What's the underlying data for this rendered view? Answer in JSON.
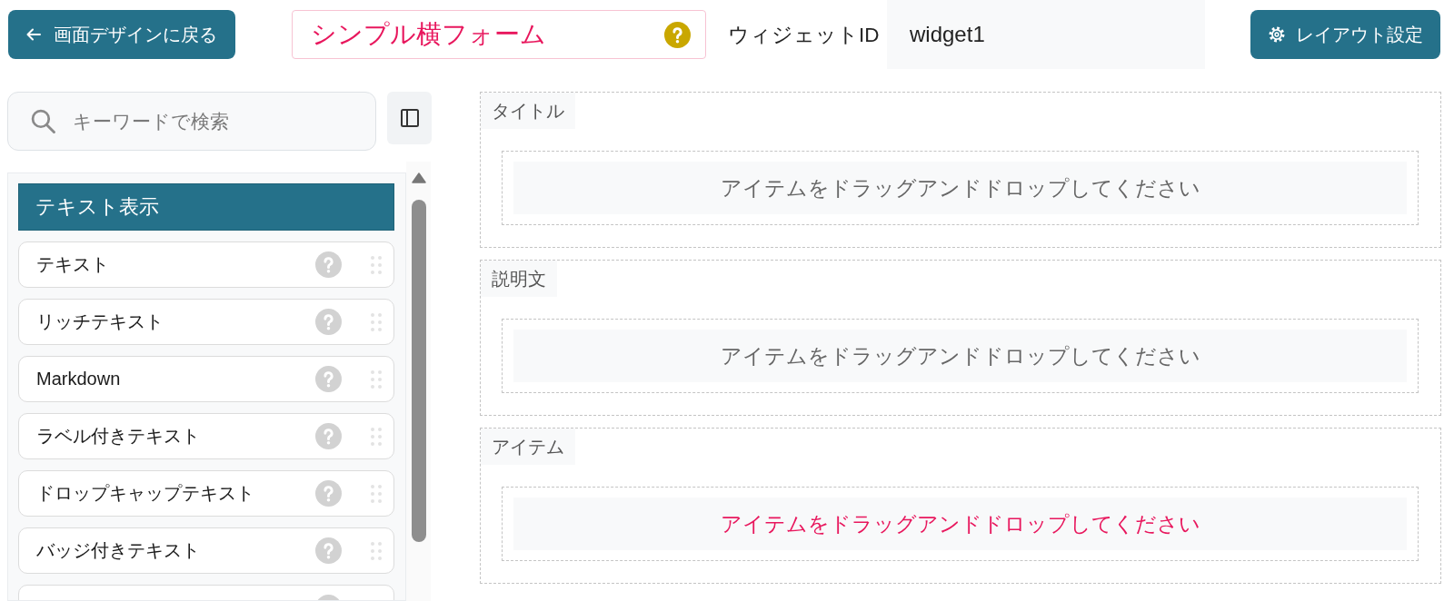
{
  "header": {
    "back_button": {
      "label": "画面デザインに戻る"
    },
    "title_field": {
      "value": "シンプル横フォーム"
    },
    "widget_id": {
      "label": "ウィジェットID",
      "value": "widget1"
    },
    "layout_button": {
      "label": "レイアウト設定"
    }
  },
  "sidebar": {
    "search": {
      "placeholder": "キーワードで検索"
    },
    "category": {
      "title": "テキスト表示",
      "items": [
        {
          "label": "テキスト"
        },
        {
          "label": "リッチテキスト"
        },
        {
          "label": "Markdown"
        },
        {
          "label": "ラベル付きテキスト"
        },
        {
          "label": "ドロップキャップテキスト"
        },
        {
          "label": "バッジ付きテキスト"
        }
      ]
    }
  },
  "canvas": {
    "sections": [
      {
        "label": "タイトル",
        "drop_hint": "アイテムをドラッグアンドドロップしてください",
        "highlighted": false
      },
      {
        "label": "説明文",
        "drop_hint": "アイテムをドラッグアンドドロップしてください",
        "highlighted": false
      },
      {
        "label": "アイテム",
        "drop_hint": "アイテムをドラッグアンドドロップしてください",
        "highlighted": true
      }
    ]
  }
}
